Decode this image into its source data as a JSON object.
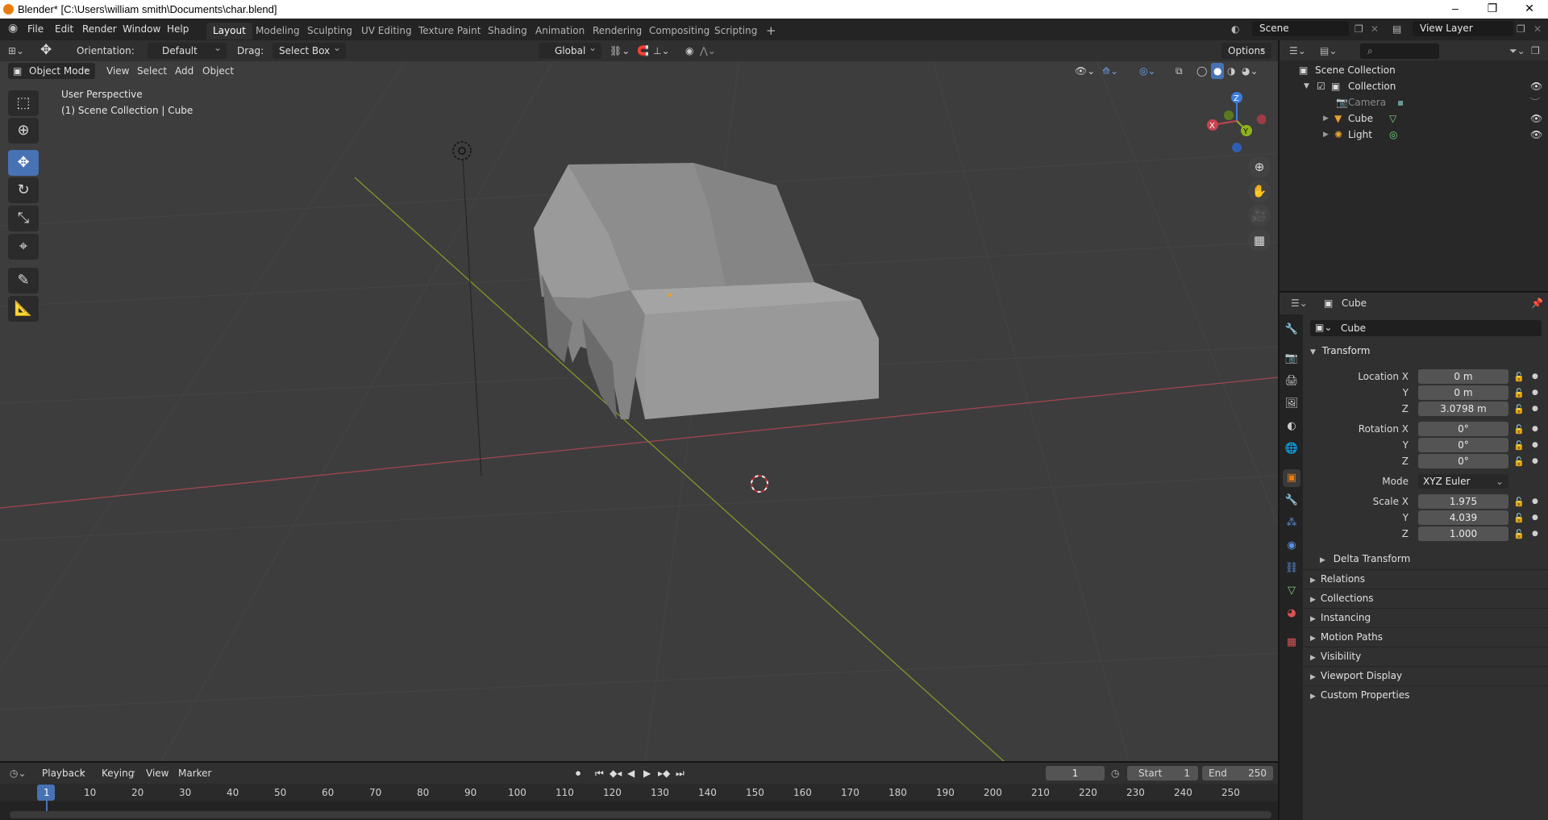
{
  "window": {
    "title": "Blender* [C:\\Users\\william smith\\Documents\\char.blend]",
    "controls": [
      "–",
      "❐",
      "✕"
    ]
  },
  "menu": {
    "items": [
      "File",
      "Edit",
      "Render",
      "Window",
      "Help"
    ],
    "workspaces": [
      "Layout",
      "Modeling",
      "Sculpting",
      "UV Editing",
      "Texture Paint",
      "Shading",
      "Animation",
      "Rendering",
      "Compositing",
      "Scripting"
    ],
    "active_workspace": "Layout",
    "add_workspace": "+",
    "scene": "Scene",
    "view_layer": "View Layer"
  },
  "toolbar": {
    "orientation_label": "Orientation:",
    "orientation_value": "Default",
    "drag_label": "Drag:",
    "drag_value": "Select Box",
    "transform_orientation": "Global",
    "options": "Options"
  },
  "viewport_header": {
    "mode": "Object Mode",
    "menus": [
      "View",
      "Select",
      "Add",
      "Object"
    ]
  },
  "viewport": {
    "perspective": "User Perspective",
    "context": "(1) Scene Collection | Cube",
    "gizmo_axes": [
      "Z",
      "X",
      "Y"
    ]
  },
  "outliner": {
    "root": "Scene Collection",
    "collection": "Collection",
    "items": [
      {
        "name": "Camera"
      },
      {
        "name": "Cube"
      },
      {
        "name": "Light"
      }
    ]
  },
  "properties": {
    "object_name": "Cube",
    "data_name": "Cube",
    "transform": {
      "title": "Transform",
      "location_label": "Location X",
      "location": [
        "0 m",
        "0 m",
        "3.0798 m"
      ],
      "rotation_label": "Rotation X",
      "rotation": [
        "0°",
        "0°",
        "0°"
      ],
      "mode_label": "Mode",
      "mode": "XYZ Euler",
      "scale_label": "Scale X",
      "scale": [
        "1.975",
        "4.039",
        "1.000"
      ],
      "axis_y": "Y",
      "axis_z": "Z",
      "delta": "Delta Transform"
    },
    "panels": [
      "Relations",
      "Collections",
      "Instancing",
      "Motion Paths",
      "Visibility",
      "Viewport Display",
      "Custom Properties"
    ]
  },
  "timeline": {
    "menus": [
      "Playback",
      "Keying",
      "View",
      "Marker"
    ],
    "current_frame": "1",
    "start_label": "Start",
    "start": "1",
    "end_label": "End",
    "end": "250",
    "ruler": [
      "1",
      "10",
      "20",
      "30",
      "40",
      "50",
      "60",
      "70",
      "80",
      "90",
      "100",
      "110",
      "120",
      "130",
      "140",
      "150",
      "160",
      "170",
      "180",
      "190",
      "200",
      "210",
      "220",
      "230",
      "240",
      "250"
    ]
  },
  "colors": {
    "accent": "#4772b3",
    "x_axis": "#c8434f",
    "y_axis": "#8fb21c",
    "z_axis": "#3d7be0",
    "active_tab_orange": "#e87d0d"
  }
}
